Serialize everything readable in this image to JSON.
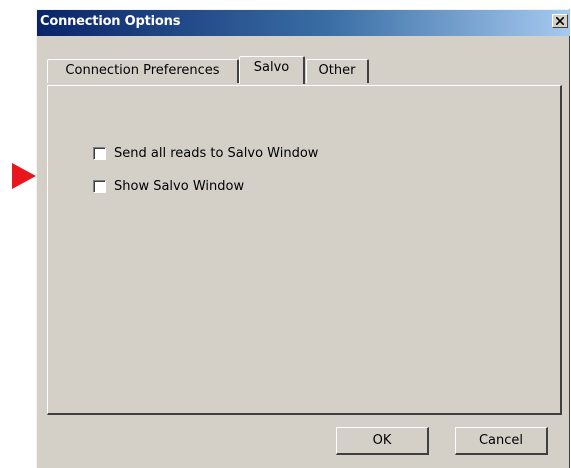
{
  "window": {
    "title": "Connection Options",
    "close_symbol": "x"
  },
  "tabs": [
    {
      "label": "Connection Preferences",
      "active": false
    },
    {
      "label": "Salvo",
      "active": true
    },
    {
      "label": "Other",
      "active": false
    }
  ],
  "options": [
    {
      "label": "Send all reads to Salvo Window",
      "checked": false
    },
    {
      "label": "Show Salvo Window",
      "checked": false
    }
  ],
  "buttons": {
    "ok": "OK",
    "cancel": "Cancel"
  },
  "annotation": {
    "icon": "pointer-arrow-icon",
    "color": "#e8141e"
  },
  "colors": {
    "face": "#d4d0c8",
    "title_bar_start": "#0a246a",
    "title_bar_end": "#a6caf0"
  }
}
